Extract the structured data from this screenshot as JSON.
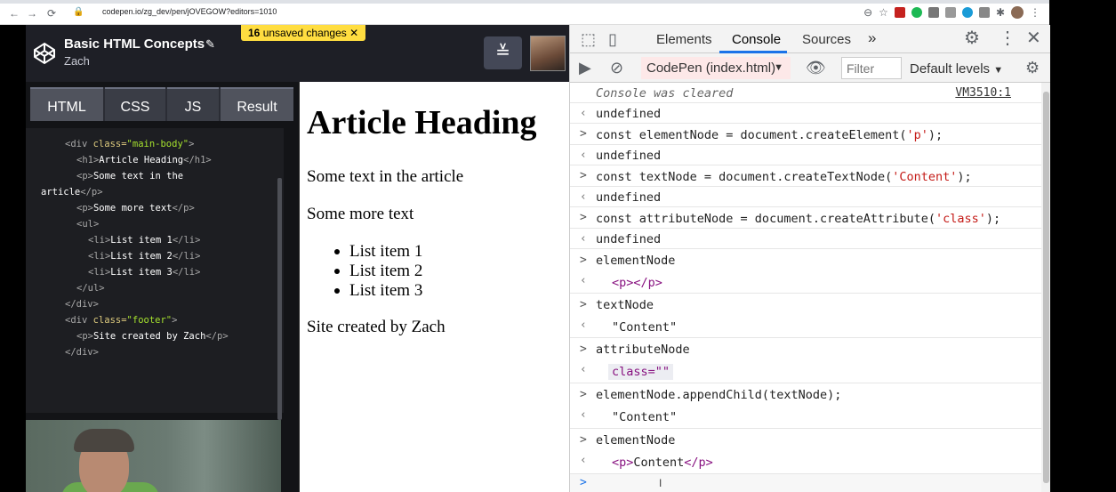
{
  "browser": {
    "url": "codepen.io/zg_dev/pen/jOVEGOW?editors=1010",
    "nav": [
      "←",
      "→",
      "⟳"
    ]
  },
  "codepen": {
    "title": "Basic HTML Concepts",
    "author": "Zach",
    "unsaved_count": "16",
    "unsaved_label": "unsaved changes",
    "tabs": [
      "HTML",
      "CSS",
      "JS",
      "Result"
    ],
    "code": {
      "line1_tag_open": "<div ",
      "line1_attr": "class=",
      "line1_val": "\"main-body\"",
      "line1_close": ">",
      "line2_open": "<h1>",
      "line2_text": "Article Heading",
      "line2_close": "</h1>",
      "line3_open": "<p>",
      "line3_text": "Some text in the",
      "line4_text": "article",
      "line4_close": "</p>",
      "line5_open": "<p>",
      "line5_text": "Some more text",
      "line5_close": "</p>",
      "line6": "<ul>",
      "li_open": "<li>",
      "li_close": "</li>",
      "li1": "List item 1",
      "li2": "List item 2",
      "li3": "List item 3",
      "line10": "</ul>",
      "line11": "</div>",
      "line12_tag_open": "<div ",
      "line12_attr": "class=",
      "line12_val": "\"footer\"",
      "line12_close": ">",
      "line13_open": "<p>",
      "line13_text": "Site created by Zach",
      "line13_close": "</p>",
      "line14": "</div>"
    }
  },
  "result": {
    "heading": "Article Heading",
    "p1": "Some text in the article",
    "p2": "Some more text",
    "items": [
      "List item 1",
      "List item 2",
      "List item 3"
    ],
    "footer": "Site created by Zach"
  },
  "devtools": {
    "tabs": [
      "Elements",
      "Console",
      "Sources"
    ],
    "more": "»",
    "context": "CodePen (index.html)",
    "filter_placeholder": "Filter",
    "levels": "Default levels",
    "cleared": "Console was cleared",
    "cleared_source": "VM3510:1",
    "undefined": "undefined",
    "cmd1_a": "const elementNode = document.createElement(",
    "cmd1_str": "'p'",
    "cmd1_b": ");",
    "cmd2_a": "const textNode = document.createTextNode(",
    "cmd2_str": "'Content'",
    "cmd2_b": ");",
    "cmd3_a": "const attributeNode = document.createAttribute(",
    "cmd3_str": "'class'",
    "cmd3_b": ");",
    "cmd4": "elementNode",
    "out4": "<p></p>",
    "cmd5": "textNode",
    "out5": "\"Content\"",
    "cmd6": "attributeNode",
    "out6": "class=\"\"",
    "cmd7": "elementNode.appendChild(textNode);",
    "out7": "\"Content\"",
    "cmd8": "elementNode",
    "out8_open": "<p>",
    "out8_text": "Content",
    "out8_close": "</p>",
    "prompt": ">"
  }
}
